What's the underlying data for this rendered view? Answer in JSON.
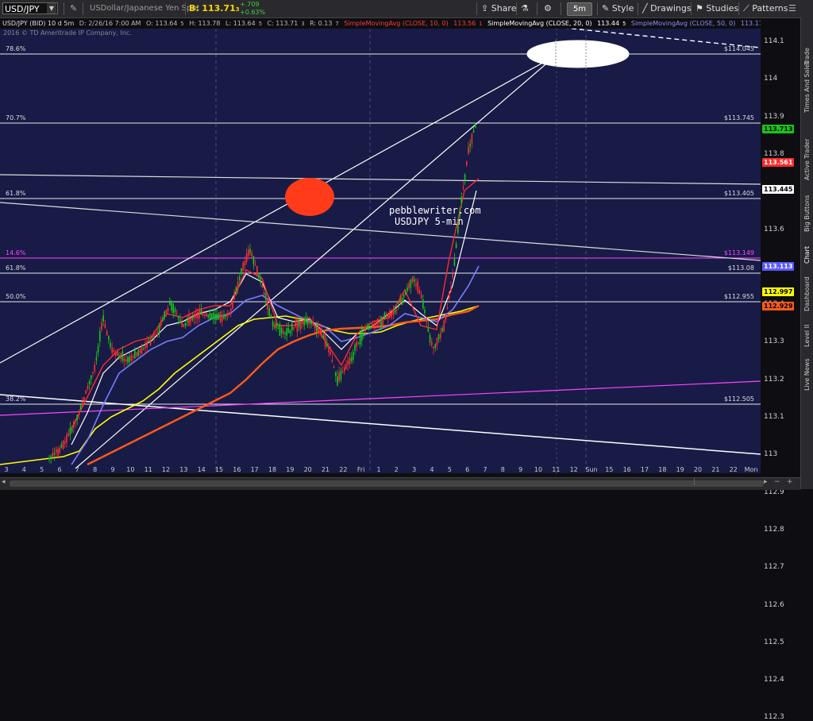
{
  "toolbar": {
    "symbol": "USD/JPY",
    "description": "USDollar/Japanese Yen Spot",
    "bid_label": "B:",
    "bid_value": "113.71",
    "bid_sub": "3",
    "change": "+.709",
    "change_pct": "+0.63%",
    "share": "Share",
    "timeframe": "5m",
    "style": "Style",
    "drawings": "Drawings",
    "studies": "Studies",
    "patterns": "Patterns"
  },
  "infobar": {
    "symbol": "USD/JPY (BID) 10 d 5m",
    "date": "D: 2/26/16 7:00 AM",
    "open": "O: 113.64",
    "open_sub": "5",
    "high": "H: 113.78",
    "low": "L: 113.64",
    "low_sub": "5",
    "close": "C: 113.71",
    "close_sub": "3",
    "range": "R: 0.13",
    "range_sub": "7",
    "sma10": "SimpleMovingAvg (CLOSE, 10, 0)",
    "sma10_value": "113.56",
    "sma10_sub": "1",
    "sma20": "SimpleMovingAvg (CLOSE, 20, 0)",
    "sma20_value": "113.44",
    "sma20_sub": "5",
    "sma50": "SimpleMovingAvg (CLOSE, 50, 0)",
    "sma50_value": "113.11",
    "sma50_sub": "3"
  },
  "copyright": "2016 © TD Ameritrade IP Company, Inc.",
  "colors": {
    "plot_bg": "#181b46",
    "sma10": "#ff2a2a",
    "sma20": "#ffffff",
    "sma50": "#7b7bff",
    "sma_yellow": "#ffff00",
    "sma_orange": "#ff5a1a",
    "magenta": "#ff44ff",
    "up_candle": "#16c716",
    "down_candle": "#ff2e2e"
  },
  "fib_levels": [
    {
      "label": "78.6%",
      "value": "$114.04",
      "sub": "5"
    },
    {
      "label": "70.7%",
      "value": "$113.74",
      "sub": "5"
    },
    {
      "label": "61.8%",
      "value": "$113.40",
      "sub": "5"
    },
    {
      "label": "14.6%",
      "value": "$113.14",
      "sub": "9"
    },
    {
      "label": "61.8%",
      "value": "$113.08",
      "sub": ""
    },
    {
      "label": "50.0%",
      "value": "$112.95",
      "sub": "5"
    },
    {
      "label": "38.2%",
      "value": "$112.50",
      "sub": "5"
    }
  ],
  "watermark": {
    "line1": "pebblewriter.com",
    "line2": "USDJPY 5-min"
  },
  "y_axis": {
    "ticks": [
      "114.1",
      "114",
      "113.9",
      "113.8",
      "113.7",
      "113.6",
      "113.5",
      "113.4",
      "113.3",
      "113.2",
      "113.1",
      "113",
      "112.9",
      "112.8",
      "112.7",
      "112.6",
      "112.5",
      "112.4",
      "112.3"
    ],
    "tags": [
      {
        "value": "113.71",
        "sub": "3",
        "color": "#16c716",
        "text": "#000"
      },
      {
        "value": "113.56",
        "sub": "1",
        "color": "#ff2a2a",
        "text": "#fff"
      },
      {
        "value": "113.44",
        "sub": "5",
        "color": "#ffffff",
        "text": "#000"
      },
      {
        "value": "113.11",
        "sub": "3",
        "color": "#5a5aff",
        "text": "#fff"
      },
      {
        "value": "112.99",
        "sub": "7",
        "color": "#ffff00",
        "text": "#000"
      },
      {
        "value": "112.92",
        "sub": "9",
        "color": "#ff5a1a",
        "text": "#000"
      }
    ]
  },
  "x_axis": {
    "ticks": [
      "3",
      "4",
      "5",
      "6",
      "7",
      "8",
      "9",
      "10",
      "11",
      "12",
      "13",
      "14",
      "15",
      "16",
      "17",
      "18",
      "19",
      "20",
      "21",
      "22",
      "Fri",
      "1",
      "2",
      "3",
      "4",
      "5",
      "6",
      "7",
      "8",
      "9",
      "10",
      "11",
      "12",
      "Sun",
      "15",
      "16",
      "17",
      "18",
      "19",
      "20",
      "21",
      "22",
      "Mon"
    ]
  },
  "side_tabs": [
    "Trade",
    "Times And Sales",
    "Active Trader",
    "Big Buttons",
    "Chart",
    "Dashboard",
    "Level II",
    "Live News"
  ]
}
